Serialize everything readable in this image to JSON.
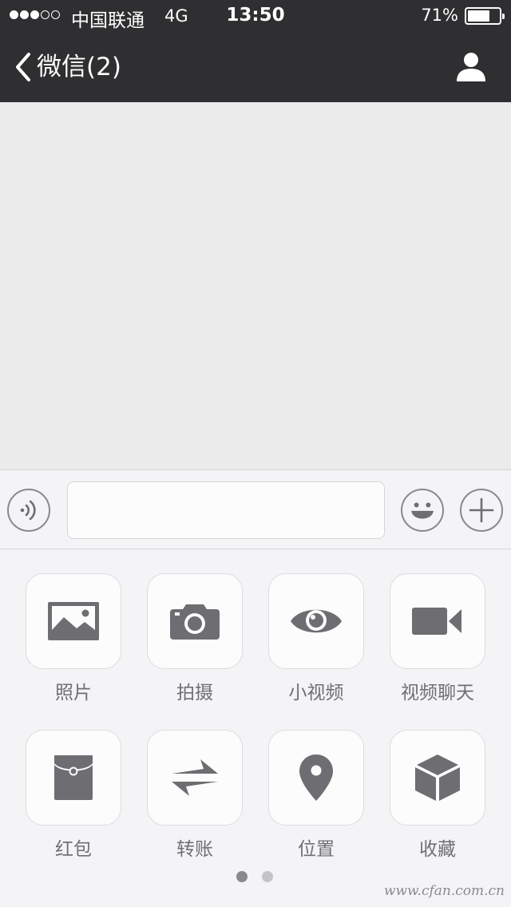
{
  "status_bar": {
    "carrier": "中国联通",
    "network": "4G",
    "time": "13:50",
    "battery_percent": "71%",
    "battery_level": 0.71,
    "signal_bars": 3,
    "signal_max": 5
  },
  "nav": {
    "back_label": "微信(2)",
    "back_icon": "chevron-left-icon",
    "profile_icon": "person-icon"
  },
  "input_bar": {
    "voice_icon": "voice-icon",
    "message_value": "",
    "emoji_icon": "smiley-icon",
    "more_icon": "plus-icon"
  },
  "panel": {
    "items": [
      {
        "label": "照片",
        "icon": "photo-icon"
      },
      {
        "label": "拍摄",
        "icon": "camera-icon"
      },
      {
        "label": "小视频",
        "icon": "eye-icon"
      },
      {
        "label": "视频聊天",
        "icon": "video-camera-icon"
      },
      {
        "label": "红包",
        "icon": "red-packet-icon"
      },
      {
        "label": "转账",
        "icon": "transfer-icon"
      },
      {
        "label": "位置",
        "icon": "location-icon"
      },
      {
        "label": "收藏",
        "icon": "favorites-cube-icon"
      }
    ],
    "page_count": 2,
    "current_page": 1
  },
  "watermark": "www.cfan.com.cn",
  "colors": {
    "topbar": "#2f2f31",
    "chat_background": "#ebebeb",
    "panel_background": "#f4f4f6",
    "icon_gray": "#6e6e72"
  }
}
